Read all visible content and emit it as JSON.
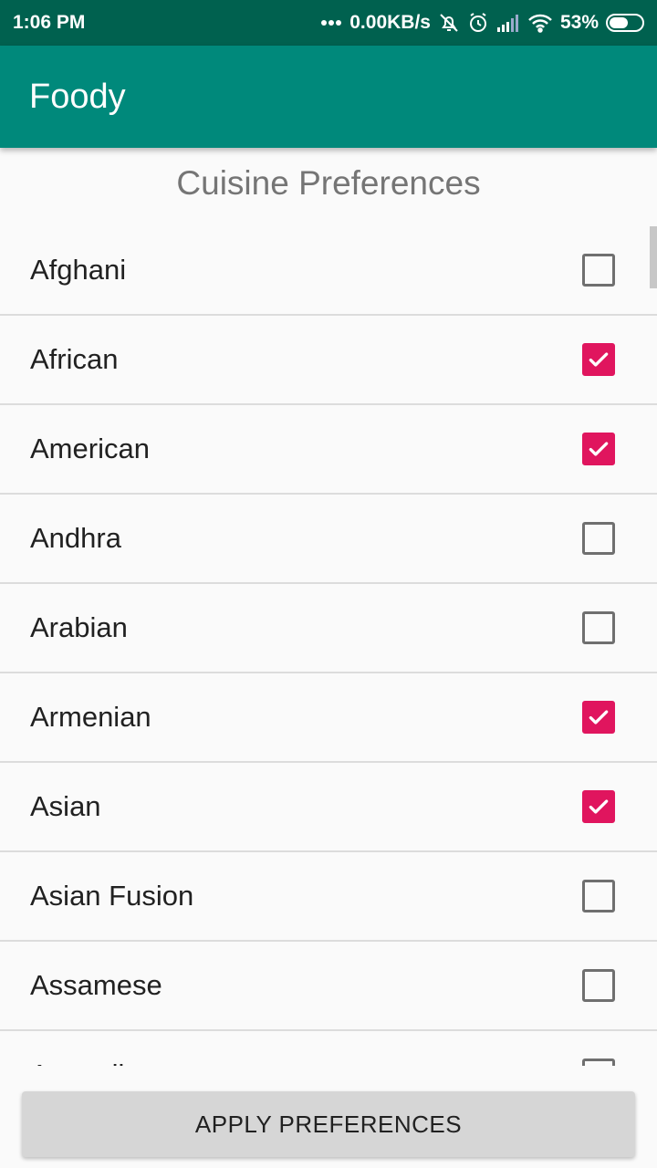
{
  "status_bar": {
    "time": "1:06 PM",
    "network_speed": "0.00KB/s",
    "battery_percent": "53%",
    "icons": [
      "dots-icon",
      "notifications-off-icon",
      "alarm-icon",
      "signal-icon",
      "wifi-icon",
      "battery-icon"
    ]
  },
  "app_bar": {
    "title": "Foody"
  },
  "section_title": "Cuisine Preferences",
  "cuisines": [
    {
      "label": "Afghani",
      "checked": false
    },
    {
      "label": "African",
      "checked": true
    },
    {
      "label": "American",
      "checked": true
    },
    {
      "label": "Andhra",
      "checked": false
    },
    {
      "label": "Arabian",
      "checked": false
    },
    {
      "label": "Armenian",
      "checked": true
    },
    {
      "label": "Asian",
      "checked": true
    },
    {
      "label": "Asian Fusion",
      "checked": false
    },
    {
      "label": "Assamese",
      "checked": false
    },
    {
      "label": "Australian",
      "checked": false
    }
  ],
  "apply_button_label": "APPLY PREFERENCES",
  "colors": {
    "status_bar": "#00614f",
    "app_bar": "#00897b",
    "checkbox_checked": "#e0155e"
  }
}
